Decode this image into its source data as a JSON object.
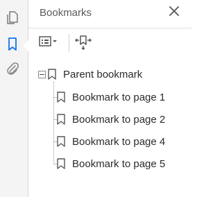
{
  "rail": {
    "items": [
      {
        "icon": "copy-pages-icon",
        "active": false
      },
      {
        "icon": "bookmark-icon",
        "active": true
      },
      {
        "icon": "paperclip-icon",
        "active": false
      }
    ],
    "accent": "#1473e6"
  },
  "panel": {
    "title": "Bookmarks",
    "close_icon": "close-icon",
    "toolbar": {
      "options_icon": "bookmark-options-icon",
      "expand_icon": "expand-current-bookmark-icon"
    }
  },
  "tree": {
    "parent": {
      "label": "Parent bookmark",
      "expanded": true
    },
    "children": [
      {
        "label": "Bookmark to page 1"
      },
      {
        "label": "Bookmark to page 2"
      },
      {
        "label": "Bookmark to page 4"
      },
      {
        "label": "Bookmark to page 5"
      }
    ]
  }
}
